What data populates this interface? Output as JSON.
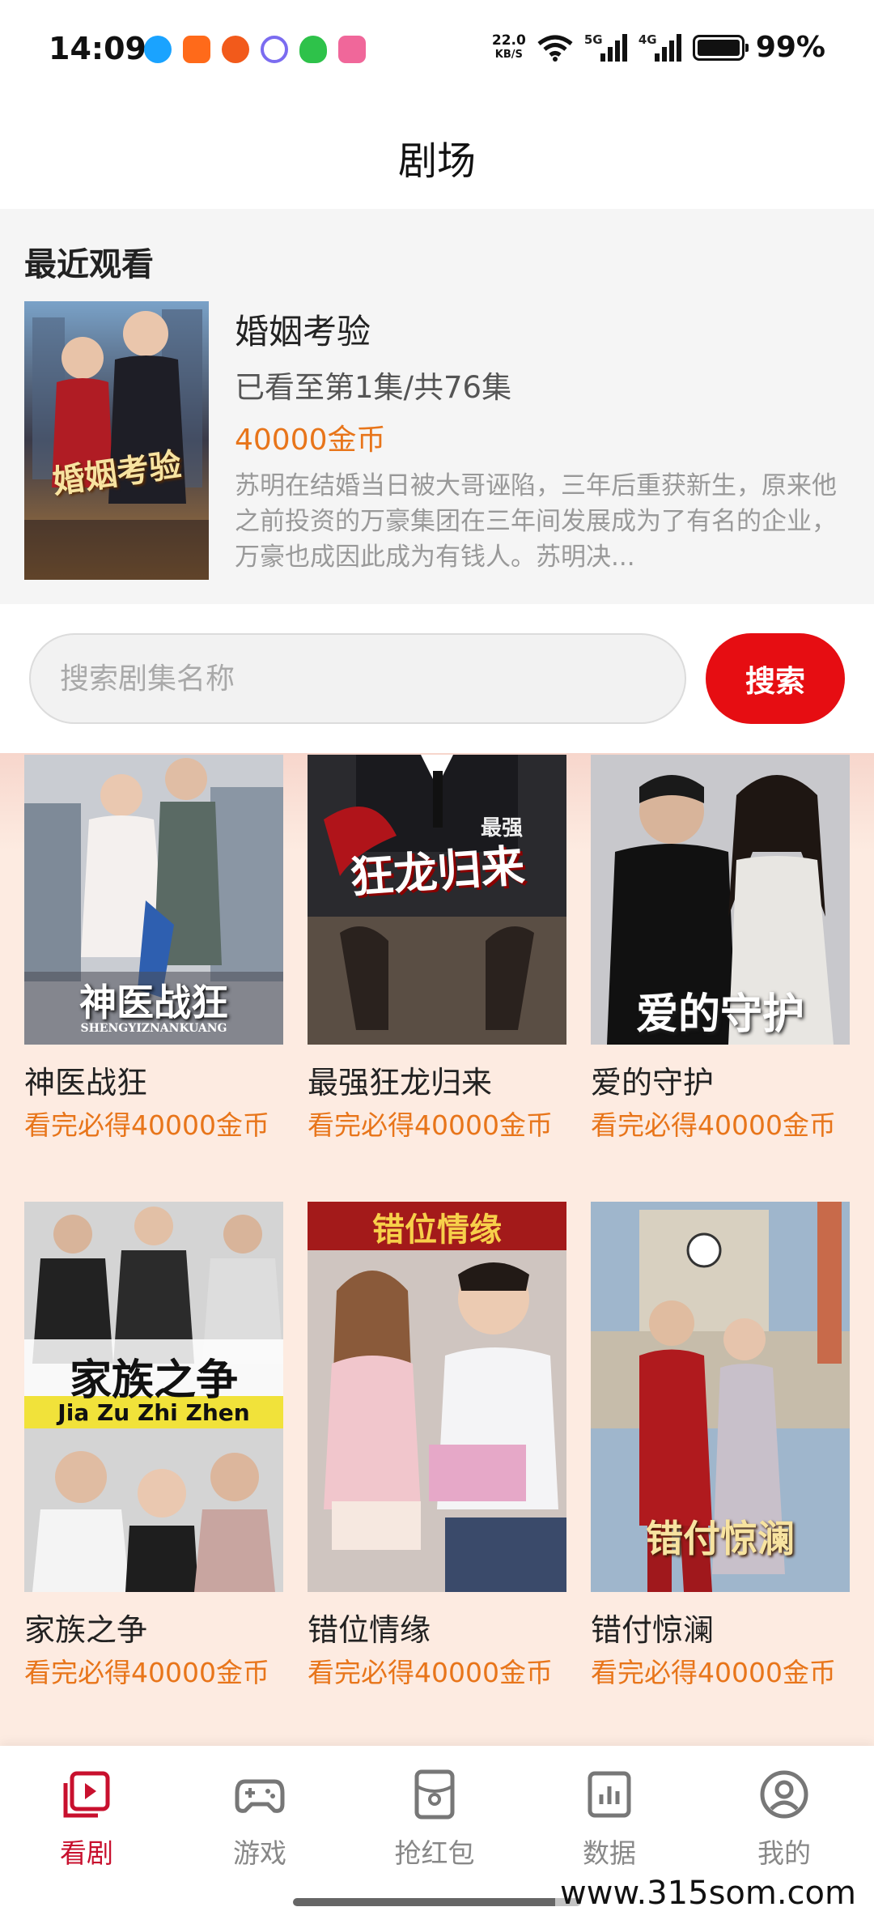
{
  "status_bar": {
    "time": "14:09",
    "net_speed_value": "22.0",
    "net_speed_unit": "KB/S",
    "signal1": "5G",
    "signal2": "4G",
    "battery": "99%",
    "app_icons": [
      "qq-icon",
      "kuaishou-icon",
      "weibo-icon",
      "app-icon",
      "shield-icon",
      "bilibili-icon"
    ]
  },
  "header": {
    "title": "剧场"
  },
  "recent": {
    "heading": "最近观看",
    "title": "婚姻考验",
    "progress": "已看至第1集/共76集",
    "coins": "40000金币",
    "description": "苏明在结婚当日被大哥诬陷，三年后重获新生，原来他之前投资的万豪集团在三年间发展成为了有名的企业，万豪也成因此成为有钱人。苏明决...",
    "poster_text": "婚姻考验"
  },
  "search": {
    "placeholder": "搜索剧集名称",
    "button": "搜索"
  },
  "dramas": [
    {
      "title": "神医战狂",
      "reward": "看完必得40000金币",
      "poster_text": "神医战狂",
      "poster_subtext": "SHENGYIZNANKUANG"
    },
    {
      "title": "最强狂龙归来",
      "reward": "看完必得40000金币",
      "poster_text": "狂龙归来",
      "poster_subtext": "最强"
    },
    {
      "title": "爱的守护",
      "reward": "看完必得40000金币",
      "poster_text": "爱的守护",
      "poster_subtext": ""
    },
    {
      "title": "家族之争",
      "reward": "看完必得40000金币",
      "poster_text": "家族之争",
      "poster_subtext": "Jia Zu Zhi Zhen"
    },
    {
      "title": "错位情缘",
      "reward": "看完必得40000金币",
      "poster_text": "错位情缘",
      "poster_subtext": ""
    },
    {
      "title": "错付惊澜",
      "reward": "看完必得40000金币",
      "poster_text": "错付惊澜",
      "poster_subtext": ""
    }
  ],
  "tabs": [
    {
      "label": "看剧",
      "icon": "video-icon",
      "active": true
    },
    {
      "label": "游戏",
      "icon": "gamepad-icon",
      "active": false
    },
    {
      "label": "抢红包",
      "icon": "red-packet-icon",
      "active": false
    },
    {
      "label": "数据",
      "icon": "bar-chart-icon",
      "active": false
    },
    {
      "label": "我的",
      "icon": "profile-icon",
      "active": false
    }
  ],
  "watermark": "www.315som.com",
  "colors": {
    "accent": "#e60d12",
    "reward": "#e8751a",
    "active_tab": "#c8102e",
    "grid_bg": "#fdebe1"
  }
}
